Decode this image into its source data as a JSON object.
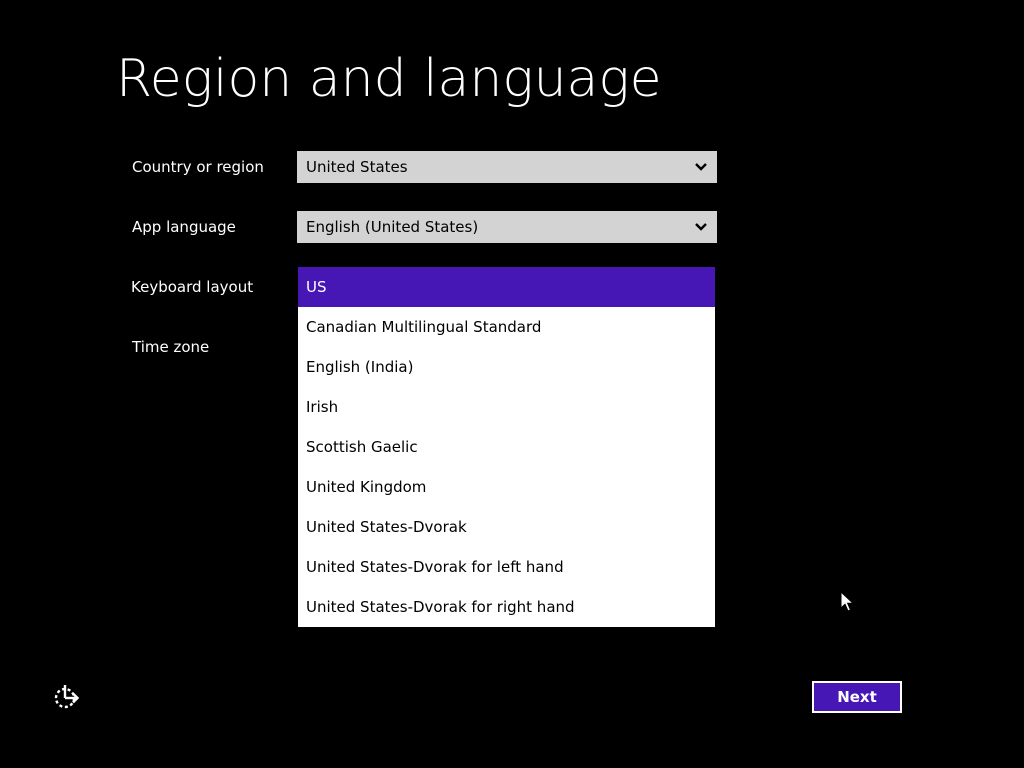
{
  "page": {
    "title": "Region and language"
  },
  "form": {
    "country": {
      "label": "Country or region",
      "value": "United States"
    },
    "app_language": {
      "label": "App language",
      "value": "English (United States)"
    },
    "keyboard_layout": {
      "label": "Keyboard layout",
      "options": [
        "US",
        "Canadian Multilingual Standard",
        "English (India)",
        "Irish",
        "Scottish Gaelic",
        "United Kingdom",
        "United States-Dvorak",
        "United States-Dvorak for left hand",
        "United States-Dvorak for right hand"
      ],
      "selected": "US"
    },
    "time_zone": {
      "label": "Time zone"
    }
  },
  "footer": {
    "next_label": "Next",
    "ease_of_access_icon": "ease-of-access-icon"
  },
  "colors": {
    "accent": "#4617b4",
    "select_bg": "#d3d3d3",
    "background": "#000000"
  }
}
